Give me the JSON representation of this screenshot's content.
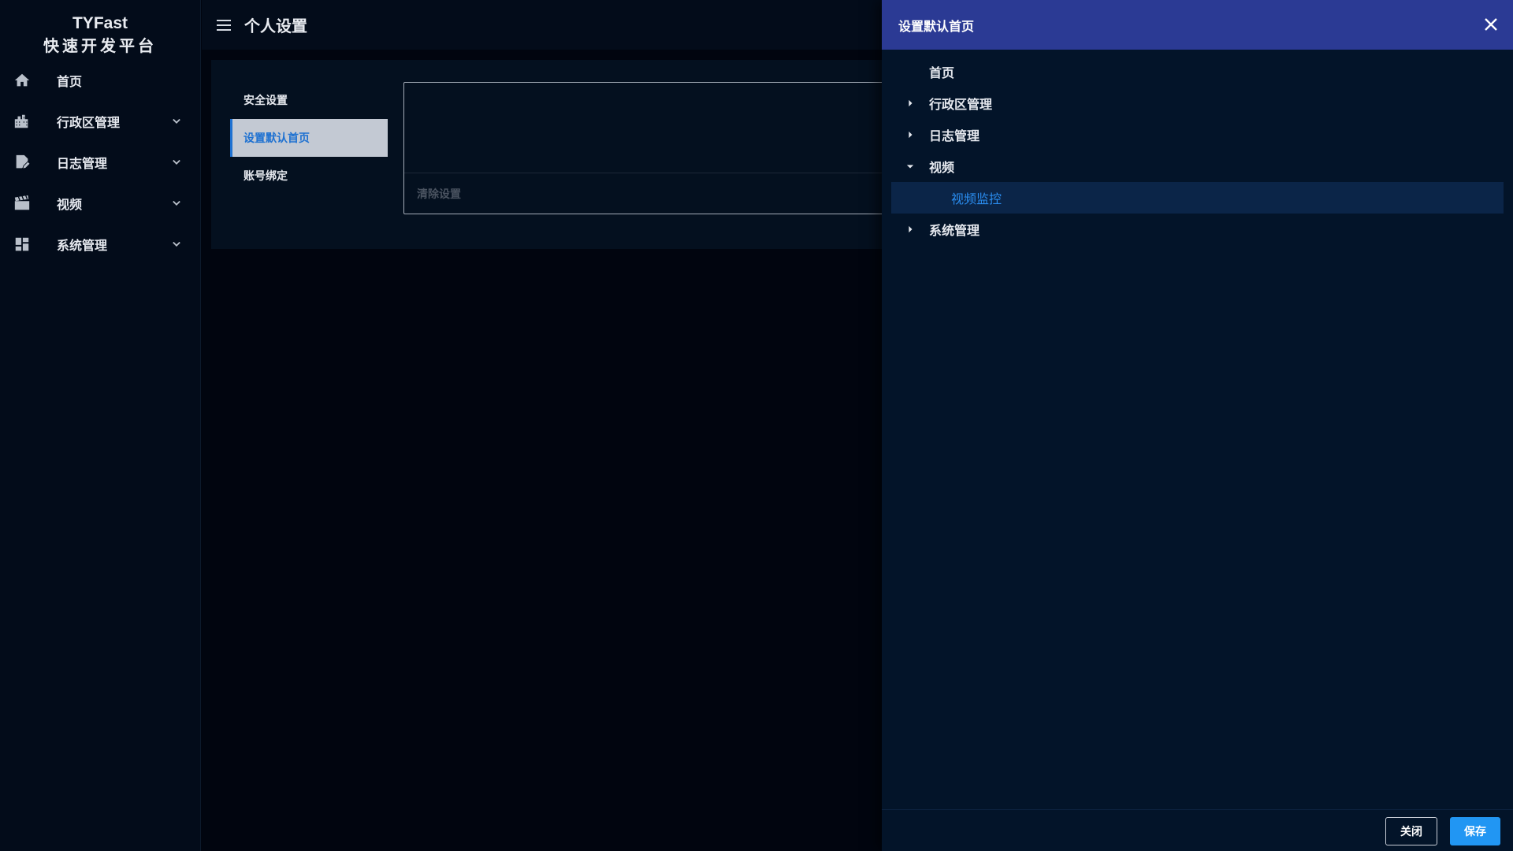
{
  "brand": {
    "title": "TYFast",
    "subtitle": "快速开发平台"
  },
  "sidebar": {
    "items": [
      {
        "label": "首页",
        "icon": "home-icon",
        "expandable": false
      },
      {
        "label": "行政区管理",
        "icon": "buildings-icon",
        "expandable": true
      },
      {
        "label": "日志管理",
        "icon": "edit-note-icon",
        "expandable": true
      },
      {
        "label": "视频",
        "icon": "video-clapper-icon",
        "expandable": true
      },
      {
        "label": "系统管理",
        "icon": "dashboard-icon",
        "expandable": true
      }
    ]
  },
  "header": {
    "title": "个人设置",
    "menu_icon": "hamburger-icon"
  },
  "settings": {
    "tabs": [
      {
        "label": "安全设置",
        "active": false
      },
      {
        "label": "设置默认首页",
        "active": true
      },
      {
        "label": "账号绑定",
        "active": false
      }
    ],
    "clear_label": "清除设置"
  },
  "drawer": {
    "title": "设置默认首页",
    "tree": [
      {
        "label": "首页",
        "expandable": false,
        "expanded": false,
        "level": 0,
        "selected": false
      },
      {
        "label": "行政区管理",
        "expandable": true,
        "expanded": false,
        "level": 0,
        "selected": false
      },
      {
        "label": "日志管理",
        "expandable": true,
        "expanded": false,
        "level": 0,
        "selected": false
      },
      {
        "label": "视频",
        "expandable": true,
        "expanded": true,
        "level": 0,
        "selected": false
      },
      {
        "label": "视频监控",
        "expandable": false,
        "expanded": false,
        "level": 1,
        "selected": true
      },
      {
        "label": "系统管理",
        "expandable": true,
        "expanded": false,
        "level": 0,
        "selected": false
      }
    ],
    "close_label": "关闭",
    "save_label": "保存"
  },
  "colors": {
    "accent": "#2196f3",
    "drawer_header": "#2b3a94",
    "selected_text": "#2a8df0",
    "active_tab_bg": "#c3c9d3"
  }
}
